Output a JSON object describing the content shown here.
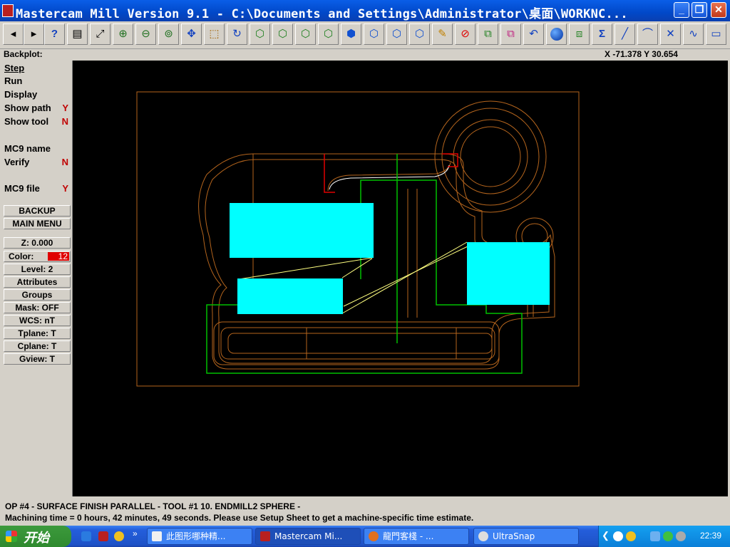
{
  "window": {
    "title": "Mastercam Mill Version 9.1 - C:\\Documents and Settings\\Administrator\\桌面\\WORKNC...",
    "buttons": [
      "minimize",
      "restore",
      "close"
    ]
  },
  "toolbar": {
    "icons": [
      "back-icon",
      "forward-icon",
      "help-icon",
      "file-icon",
      "analyze-icon",
      "zoom-icon",
      "unzoom-icon",
      "zoom-target-icon",
      "pan-icon",
      "select-icon",
      "rotate-icon",
      "iso-view-icon",
      "top-view-icon",
      "front-view-icon",
      "side-view-icon",
      "cube-view-icon",
      "cube-view-2-icon",
      "cube-view-3-icon",
      "cube-view-4-icon",
      "pencil-icon",
      "no-icon",
      "transform-icon",
      "transform-2-icon",
      "undo-icon",
      "sphere-icon",
      "layers-icon",
      "sigma-icon",
      "line-icon",
      "arc-icon",
      "trim-icon",
      "spline-icon",
      "rectangle-icon"
    ]
  },
  "header": {
    "backplot_label": "Backplot:",
    "coordinates": "X -71.378  Y 30.654"
  },
  "menu": {
    "step": "Step",
    "run": "Run",
    "display": "Display",
    "show_path": "Show path",
    "show_path_flag": "Y",
    "show_tool": "Show tool",
    "show_tool_flag": "N",
    "mc9_name": "MC9 name",
    "verify": "Verify",
    "verify_flag": "N",
    "mc9_file": "MC9 file",
    "mc9_file_flag": "Y",
    "backup": "BACKUP",
    "main_menu": "MAIN MENU"
  },
  "status": {
    "z": "Z:   0.000",
    "color_label": "Color:",
    "color_value": "12",
    "level": "Level:  2",
    "attributes": "Attributes",
    "groups": "Groups",
    "mask": "Mask:  OFF",
    "wcs": "WCS:  nT",
    "tplane": "Tplane:  T",
    "cplane": "Cplane:  T",
    "gview": "Gview:   T"
  },
  "messages": {
    "line1": "OP #4 - SURFACE FINISH PARALLEL - TOOL #1 10. ENDMILL2 SPHERE -",
    "line2": "Machining time = 0 hours, 42 minutes, 49 seconds. Please use Setup Sheet to get a machine-specific time estimate."
  },
  "taskbar": {
    "start_label": "开始",
    "tasks": [
      {
        "label": "此图形哪种精...",
        "active": false
      },
      {
        "label": "Mastercam Mi...",
        "active": true
      },
      {
        "label": "龍門客棧 - ...",
        "active": false
      },
      {
        "label": "UltraSnap",
        "active": false
      }
    ],
    "clock": "22:39"
  },
  "colors": {
    "geometry": "#b5651d",
    "boundary": "#00c000",
    "toolpath": "#00ffff",
    "highlight": "#e00000",
    "link": "#ffff80"
  }
}
